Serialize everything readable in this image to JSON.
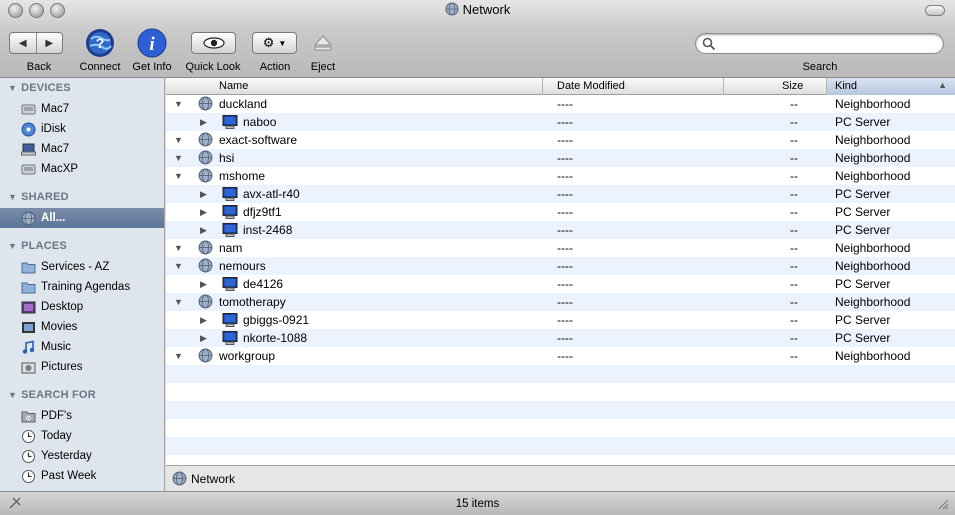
{
  "window": {
    "title": "Network"
  },
  "toolbar": {
    "back_label": "Back",
    "connect_label": "Connect",
    "getinfo_label": "Get Info",
    "quicklook_label": "Quick Look",
    "action_label": "Action",
    "eject_label": "Eject",
    "search_label": "Search",
    "search_value": ""
  },
  "sidebar": {
    "devices_header": "DEVICES",
    "devices": [
      {
        "label": "Mac7",
        "icon": "hard-drive-icon"
      },
      {
        "label": "iDisk",
        "icon": "idisk-icon"
      },
      {
        "label": "Mac7",
        "icon": "laptop-icon"
      },
      {
        "label": "MacXP",
        "icon": "hard-drive-icon"
      }
    ],
    "shared_header": "SHARED",
    "shared": [
      {
        "label": "All...",
        "icon": "network-globe-icon",
        "selected": true
      }
    ],
    "places_header": "PLACES",
    "places": [
      {
        "label": "Services - AZ",
        "icon": "folder-icon"
      },
      {
        "label": "Training Agendas",
        "icon": "folder-icon"
      },
      {
        "label": "Desktop",
        "icon": "desktop-icon"
      },
      {
        "label": "Movies",
        "icon": "movies-icon"
      },
      {
        "label": "Music",
        "icon": "music-icon"
      },
      {
        "label": "Pictures",
        "icon": "pictures-icon"
      }
    ],
    "search_header": "SEARCH FOR",
    "search": [
      {
        "label": "PDF's",
        "icon": "smart-folder-icon"
      },
      {
        "label": "Today",
        "icon": "clock-icon"
      },
      {
        "label": "Yesterday",
        "icon": "clock-icon"
      },
      {
        "label": "Past Week",
        "icon": "clock-icon"
      }
    ]
  },
  "columns": {
    "name": "Name",
    "date": "Date Modified",
    "size": "Size",
    "kind": "Kind"
  },
  "rows": [
    {
      "name": "duckland",
      "date": "----",
      "size": "--",
      "kind": "Neighborhood",
      "level": 0,
      "icon": "network-globe-icon",
      "expanded": true
    },
    {
      "name": "naboo",
      "date": "----",
      "size": "--",
      "kind": "PC Server",
      "level": 1,
      "icon": "pc-server-icon",
      "expanded": false
    },
    {
      "name": "exact-software",
      "date": "----",
      "size": "--",
      "kind": "Neighborhood",
      "level": 0,
      "icon": "network-globe-icon",
      "expanded": true
    },
    {
      "name": "hsi",
      "date": "----",
      "size": "--",
      "kind": "Neighborhood",
      "level": 0,
      "icon": "network-globe-icon",
      "expanded": true
    },
    {
      "name": "mshome",
      "date": "----",
      "size": "--",
      "kind": "Neighborhood",
      "level": 0,
      "icon": "network-globe-icon",
      "expanded": true
    },
    {
      "name": "avx-atl-r40",
      "date": "----",
      "size": "--",
      "kind": "PC Server",
      "level": 1,
      "icon": "pc-server-icon",
      "expanded": false
    },
    {
      "name": "dfjz9tf1",
      "date": "----",
      "size": "--",
      "kind": "PC Server",
      "level": 1,
      "icon": "pc-server-icon",
      "expanded": false
    },
    {
      "name": "inst-2468",
      "date": "----",
      "size": "--",
      "kind": "PC Server",
      "level": 1,
      "icon": "pc-server-icon",
      "expanded": false
    },
    {
      "name": "nam",
      "date": "----",
      "size": "--",
      "kind": "Neighborhood",
      "level": 0,
      "icon": "network-globe-icon",
      "expanded": true
    },
    {
      "name": "nemours",
      "date": "----",
      "size": "--",
      "kind": "Neighborhood",
      "level": 0,
      "icon": "network-globe-icon",
      "expanded": true
    },
    {
      "name": "de4126",
      "date": "----",
      "size": "--",
      "kind": "PC Server",
      "level": 1,
      "icon": "pc-server-icon",
      "expanded": false
    },
    {
      "name": "tomotherapy",
      "date": "----",
      "size": "--",
      "kind": "Neighborhood",
      "level": 0,
      "icon": "network-globe-icon",
      "expanded": true
    },
    {
      "name": "gbiggs-0921",
      "date": "----",
      "size": "--",
      "kind": "PC Server",
      "level": 1,
      "icon": "pc-server-icon",
      "expanded": false
    },
    {
      "name": "nkorte-1088",
      "date": "----",
      "size": "--",
      "kind": "PC Server",
      "level": 1,
      "icon": "pc-server-icon",
      "expanded": false
    },
    {
      "name": "workgroup",
      "date": "----",
      "size": "--",
      "kind": "Neighborhood",
      "level": 0,
      "icon": "network-globe-icon",
      "expanded": true
    }
  ],
  "pathbar": {
    "label": "Network"
  },
  "status": {
    "count": "15 items"
  },
  "colors": {
    "selection": "#5c7497",
    "sidebar_bg": "#dfe5ed",
    "row_alt": "#edf3fe"
  }
}
